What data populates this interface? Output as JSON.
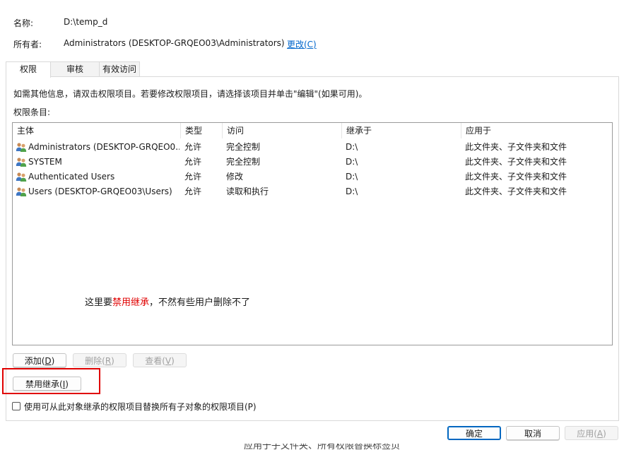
{
  "header": {
    "name_label": "名称:",
    "name_value": "D:\\temp_d",
    "owner_label": "所有者:",
    "owner_value": "Administrators (DESKTOP-GRQEO03\\Administrators)",
    "change_link": "更改(C)"
  },
  "tabs": [
    {
      "label": "权限",
      "active": true
    },
    {
      "label": "审核",
      "active": false
    },
    {
      "label": "有效访问",
      "active": false
    }
  ],
  "instructions": "如需其他信息，请双击权限项目。若要修改权限项目，请选择该项目并单击\"编辑\"(如果可用)。",
  "entries_label": "权限条目:",
  "table": {
    "columns": [
      "主体",
      "类型",
      "访问",
      "继承于",
      "应用于"
    ],
    "rows": [
      {
        "principal": "Administrators (DESKTOP-GRQEO0...",
        "type": "允许",
        "access": "完全控制",
        "inherited": "D:\\",
        "applies": "此文件夹、子文件夹和文件",
        "icon": "users-icon"
      },
      {
        "principal": "SYSTEM",
        "type": "允许",
        "access": "完全控制",
        "inherited": "D:\\",
        "applies": "此文件夹、子文件夹和文件",
        "icon": "users-icon"
      },
      {
        "principal": "Authenticated Users",
        "type": "允许",
        "access": "修改",
        "inherited": "D:\\",
        "applies": "此文件夹、子文件夹和文件",
        "icon": "users-icon"
      },
      {
        "principal": "Users (DESKTOP-GRQEO03\\Users)",
        "type": "允许",
        "access": "读取和执行",
        "inherited": "D:\\",
        "applies": "此文件夹、子文件夹和文件",
        "icon": "users-icon"
      }
    ]
  },
  "annotation": {
    "prefix": "这里要",
    "highlight": "禁用继承",
    "suffix": "，不然有些用户删除不了",
    "highlight_color": "#e00000"
  },
  "buttons": {
    "add": {
      "label": "添加(",
      "key": "D",
      "end": ")"
    },
    "remove": {
      "label": "删除(",
      "key": "R",
      "end": ")"
    },
    "view": {
      "label": "查看(",
      "key": "V",
      "end": ")"
    },
    "disable_inheritance": {
      "label": "禁用继承(",
      "key": "I",
      "end": ")"
    },
    "ok": "确定",
    "cancel": "取消",
    "apply": {
      "label": "应用(",
      "key": "A",
      "end": ")"
    }
  },
  "checkbox": {
    "label": "使用可从此对象继承的权限项目替换所有子对象的权限项目(P)",
    "checked": false
  },
  "bottom_fragment": "应用于子文件夹、所有权限替换标签页",
  "colors": {
    "accent": "#0067c0",
    "link": "#0066cc",
    "highlight_box": "#e00000"
  }
}
